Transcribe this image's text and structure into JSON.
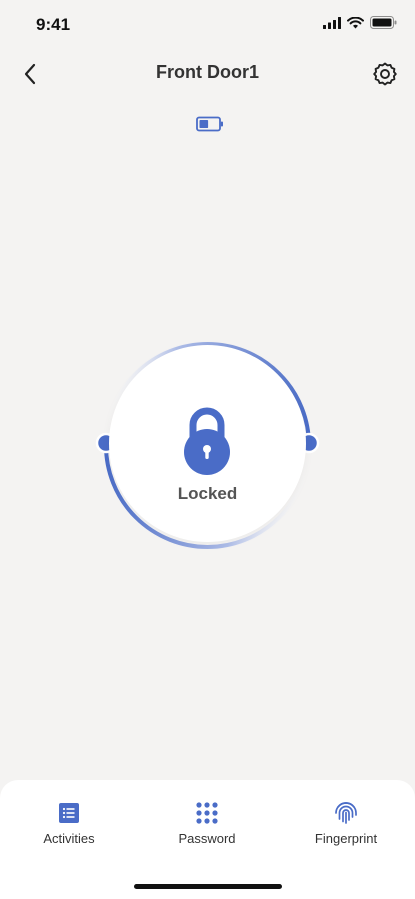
{
  "status_bar": {
    "time": "9:41",
    "icons": [
      "signal-icon",
      "wifi-icon",
      "battery-icon"
    ]
  },
  "header": {
    "title": "Front Door1",
    "back_icon": "chevron-left-icon",
    "settings_icon": "gear-icon"
  },
  "device": {
    "battery_icon": "battery-icon",
    "battery_level": 0.45,
    "lock_state_label": "Locked",
    "lock_icon": "padlock-icon"
  },
  "bottom_tabs": [
    {
      "label": "Activities",
      "icon": "list-icon"
    },
    {
      "label": "Password",
      "icon": "keypad-icon"
    },
    {
      "label": "Fingerprint",
      "icon": "fingerprint-icon"
    }
  ],
  "colors": {
    "accent": "#4a6cc7",
    "background": "#f4f3f2",
    "panel": "#ffffff"
  }
}
